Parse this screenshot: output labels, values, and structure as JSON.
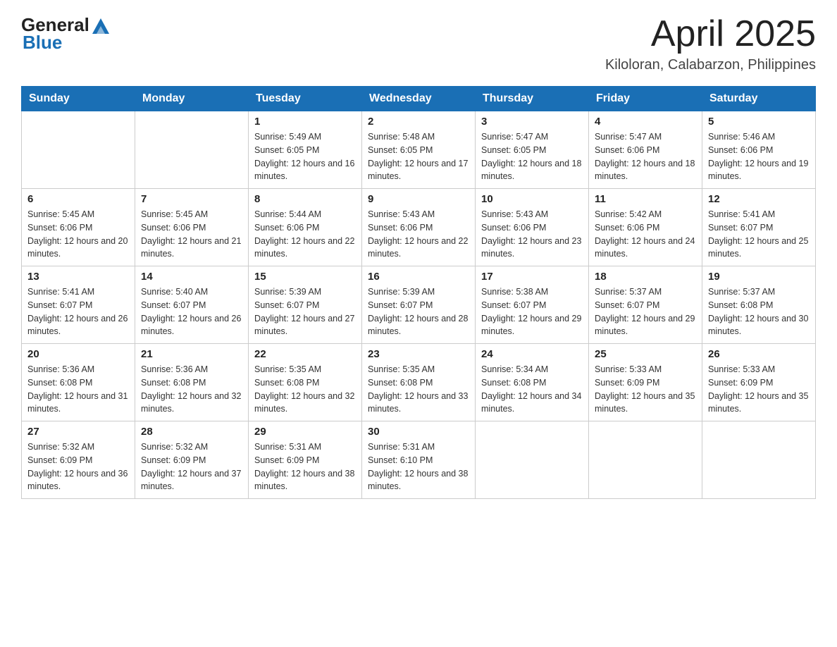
{
  "header": {
    "logo_general": "General",
    "logo_blue": "Blue",
    "month_year": "April 2025",
    "location": "Kiloloran, Calabarzon, Philippines"
  },
  "weekdays": [
    "Sunday",
    "Monday",
    "Tuesday",
    "Wednesday",
    "Thursday",
    "Friday",
    "Saturday"
  ],
  "weeks": [
    [
      {
        "day": "",
        "sunrise": "",
        "sunset": "",
        "daylight": ""
      },
      {
        "day": "",
        "sunrise": "",
        "sunset": "",
        "daylight": ""
      },
      {
        "day": "1",
        "sunrise": "Sunrise: 5:49 AM",
        "sunset": "Sunset: 6:05 PM",
        "daylight": "Daylight: 12 hours and 16 minutes."
      },
      {
        "day": "2",
        "sunrise": "Sunrise: 5:48 AM",
        "sunset": "Sunset: 6:05 PM",
        "daylight": "Daylight: 12 hours and 17 minutes."
      },
      {
        "day": "3",
        "sunrise": "Sunrise: 5:47 AM",
        "sunset": "Sunset: 6:05 PM",
        "daylight": "Daylight: 12 hours and 18 minutes."
      },
      {
        "day": "4",
        "sunrise": "Sunrise: 5:47 AM",
        "sunset": "Sunset: 6:06 PM",
        "daylight": "Daylight: 12 hours and 18 minutes."
      },
      {
        "day": "5",
        "sunrise": "Sunrise: 5:46 AM",
        "sunset": "Sunset: 6:06 PM",
        "daylight": "Daylight: 12 hours and 19 minutes."
      }
    ],
    [
      {
        "day": "6",
        "sunrise": "Sunrise: 5:45 AM",
        "sunset": "Sunset: 6:06 PM",
        "daylight": "Daylight: 12 hours and 20 minutes."
      },
      {
        "day": "7",
        "sunrise": "Sunrise: 5:45 AM",
        "sunset": "Sunset: 6:06 PM",
        "daylight": "Daylight: 12 hours and 21 minutes."
      },
      {
        "day": "8",
        "sunrise": "Sunrise: 5:44 AM",
        "sunset": "Sunset: 6:06 PM",
        "daylight": "Daylight: 12 hours and 22 minutes."
      },
      {
        "day": "9",
        "sunrise": "Sunrise: 5:43 AM",
        "sunset": "Sunset: 6:06 PM",
        "daylight": "Daylight: 12 hours and 22 minutes."
      },
      {
        "day": "10",
        "sunrise": "Sunrise: 5:43 AM",
        "sunset": "Sunset: 6:06 PM",
        "daylight": "Daylight: 12 hours and 23 minutes."
      },
      {
        "day": "11",
        "sunrise": "Sunrise: 5:42 AM",
        "sunset": "Sunset: 6:06 PM",
        "daylight": "Daylight: 12 hours and 24 minutes."
      },
      {
        "day": "12",
        "sunrise": "Sunrise: 5:41 AM",
        "sunset": "Sunset: 6:07 PM",
        "daylight": "Daylight: 12 hours and 25 minutes."
      }
    ],
    [
      {
        "day": "13",
        "sunrise": "Sunrise: 5:41 AM",
        "sunset": "Sunset: 6:07 PM",
        "daylight": "Daylight: 12 hours and 26 minutes."
      },
      {
        "day": "14",
        "sunrise": "Sunrise: 5:40 AM",
        "sunset": "Sunset: 6:07 PM",
        "daylight": "Daylight: 12 hours and 26 minutes."
      },
      {
        "day": "15",
        "sunrise": "Sunrise: 5:39 AM",
        "sunset": "Sunset: 6:07 PM",
        "daylight": "Daylight: 12 hours and 27 minutes."
      },
      {
        "day": "16",
        "sunrise": "Sunrise: 5:39 AM",
        "sunset": "Sunset: 6:07 PM",
        "daylight": "Daylight: 12 hours and 28 minutes."
      },
      {
        "day": "17",
        "sunrise": "Sunrise: 5:38 AM",
        "sunset": "Sunset: 6:07 PM",
        "daylight": "Daylight: 12 hours and 29 minutes."
      },
      {
        "day": "18",
        "sunrise": "Sunrise: 5:37 AM",
        "sunset": "Sunset: 6:07 PM",
        "daylight": "Daylight: 12 hours and 29 minutes."
      },
      {
        "day": "19",
        "sunrise": "Sunrise: 5:37 AM",
        "sunset": "Sunset: 6:08 PM",
        "daylight": "Daylight: 12 hours and 30 minutes."
      }
    ],
    [
      {
        "day": "20",
        "sunrise": "Sunrise: 5:36 AM",
        "sunset": "Sunset: 6:08 PM",
        "daylight": "Daylight: 12 hours and 31 minutes."
      },
      {
        "day": "21",
        "sunrise": "Sunrise: 5:36 AM",
        "sunset": "Sunset: 6:08 PM",
        "daylight": "Daylight: 12 hours and 32 minutes."
      },
      {
        "day": "22",
        "sunrise": "Sunrise: 5:35 AM",
        "sunset": "Sunset: 6:08 PM",
        "daylight": "Daylight: 12 hours and 32 minutes."
      },
      {
        "day": "23",
        "sunrise": "Sunrise: 5:35 AM",
        "sunset": "Sunset: 6:08 PM",
        "daylight": "Daylight: 12 hours and 33 minutes."
      },
      {
        "day": "24",
        "sunrise": "Sunrise: 5:34 AM",
        "sunset": "Sunset: 6:08 PM",
        "daylight": "Daylight: 12 hours and 34 minutes."
      },
      {
        "day": "25",
        "sunrise": "Sunrise: 5:33 AM",
        "sunset": "Sunset: 6:09 PM",
        "daylight": "Daylight: 12 hours and 35 minutes."
      },
      {
        "day": "26",
        "sunrise": "Sunrise: 5:33 AM",
        "sunset": "Sunset: 6:09 PM",
        "daylight": "Daylight: 12 hours and 35 minutes."
      }
    ],
    [
      {
        "day": "27",
        "sunrise": "Sunrise: 5:32 AM",
        "sunset": "Sunset: 6:09 PM",
        "daylight": "Daylight: 12 hours and 36 minutes."
      },
      {
        "day": "28",
        "sunrise": "Sunrise: 5:32 AM",
        "sunset": "Sunset: 6:09 PM",
        "daylight": "Daylight: 12 hours and 37 minutes."
      },
      {
        "day": "29",
        "sunrise": "Sunrise: 5:31 AM",
        "sunset": "Sunset: 6:09 PM",
        "daylight": "Daylight: 12 hours and 38 minutes."
      },
      {
        "day": "30",
        "sunrise": "Sunrise: 5:31 AM",
        "sunset": "Sunset: 6:10 PM",
        "daylight": "Daylight: 12 hours and 38 minutes."
      },
      {
        "day": "",
        "sunrise": "",
        "sunset": "",
        "daylight": ""
      },
      {
        "day": "",
        "sunrise": "",
        "sunset": "",
        "daylight": ""
      },
      {
        "day": "",
        "sunrise": "",
        "sunset": "",
        "daylight": ""
      }
    ]
  ]
}
